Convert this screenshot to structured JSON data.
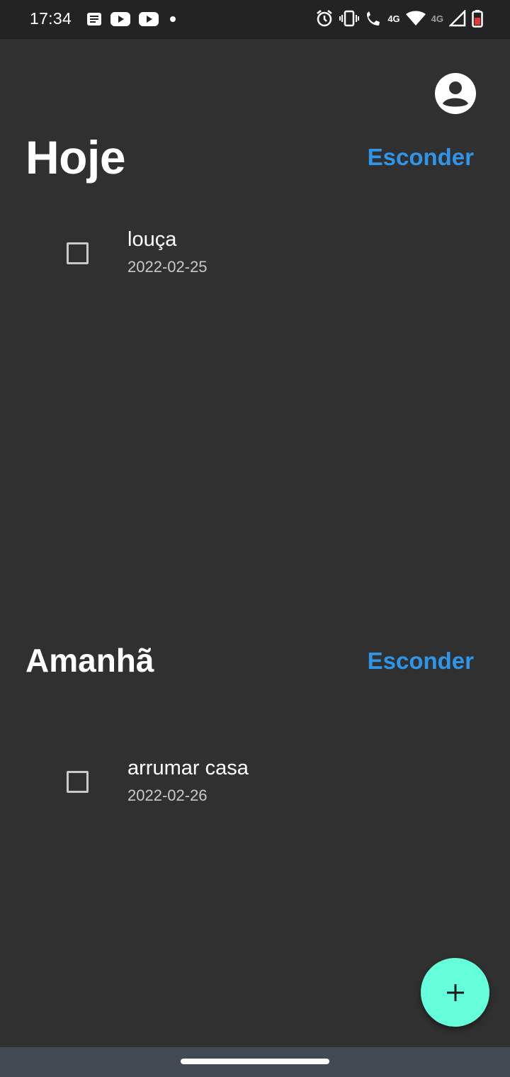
{
  "status_bar": {
    "time": "17:34",
    "left_icons": [
      "news-icon",
      "youtube-icon",
      "youtube-icon",
      "dot-icon"
    ],
    "right_icons": [
      "alarm-icon",
      "vibrate-icon",
      "wifi-calling-icon",
      "wifi-icon",
      "signal-icon",
      "battery-icon"
    ],
    "net_label_1": "4G",
    "net_label_2": "4G"
  },
  "header": {
    "profile_icon": "account-circle-icon"
  },
  "sections": {
    "today": {
      "title": "Hoje",
      "hide_label": "Esconder",
      "tasks": [
        {
          "title": "louça",
          "date": "2022-02-25",
          "checked": false
        }
      ]
    },
    "tomorrow": {
      "title": "Amanhã",
      "hide_label": "Esconder",
      "tasks": [
        {
          "title": "arrumar casa",
          "date": "2022-02-26",
          "checked": false
        }
      ]
    }
  },
  "fab": {
    "icon": "plus-icon"
  },
  "colors": {
    "background": "#303030",
    "accent": "#2f95e8",
    "fab": "#64ffda",
    "navbar": "#414a52"
  }
}
